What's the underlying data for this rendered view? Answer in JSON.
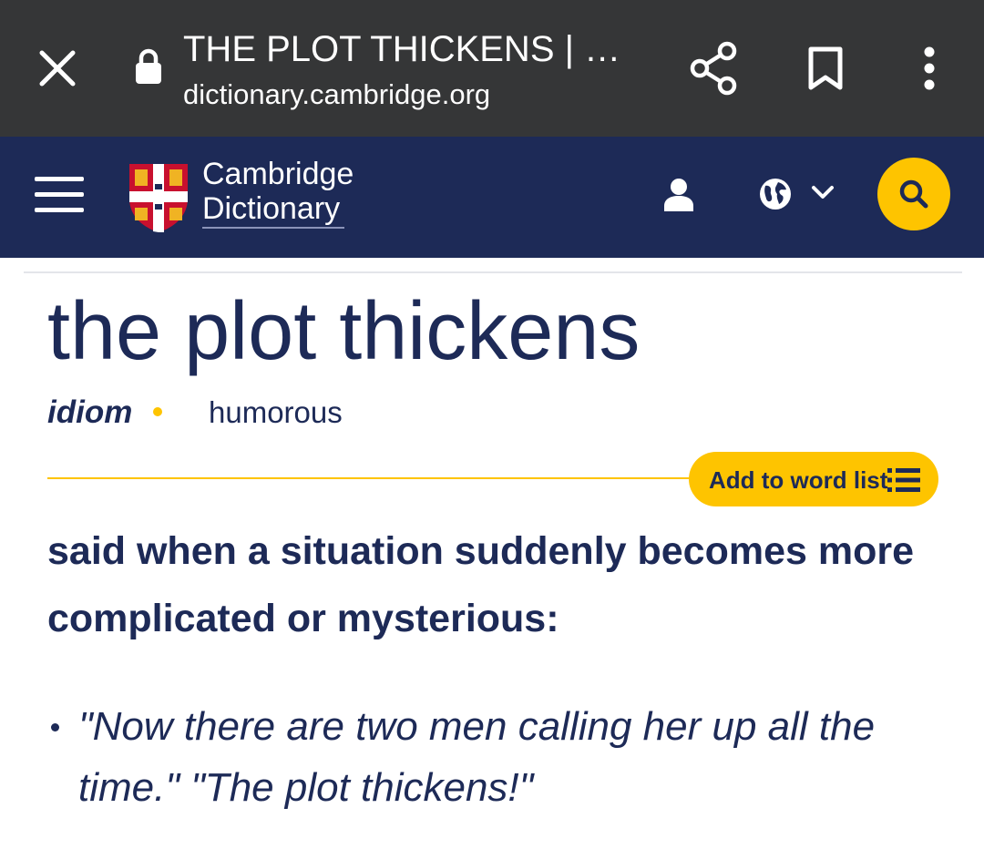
{
  "tabbar": {
    "title": "THE PLOT THICKENS | …",
    "url": "dictionary.cambridge.org",
    "icons": [
      "close-icon",
      "lock-icon",
      "share-icon",
      "bookmark-icon",
      "more-vert-icon"
    ]
  },
  "header": {
    "logo_line1": "Cambridge",
    "logo_line2": "Dictionary",
    "icons": [
      "menu-icon",
      "crest-logo",
      "user-icon",
      "globe-icon",
      "chevron-down-icon",
      "search-icon"
    ],
    "accent_color": "#fec400",
    "bar_color": "#1d2a57"
  },
  "entry": {
    "headword": "the plot thickens",
    "part_of_speech": "idiom",
    "usage_label": "humorous",
    "add_to_word_list": "Add to word list",
    "definition": "said when a situation suddenly becomes more complicated or mysterious:",
    "example": "\"Now there are two men calling her up all the time.\" \"The plot thickens!\""
  }
}
